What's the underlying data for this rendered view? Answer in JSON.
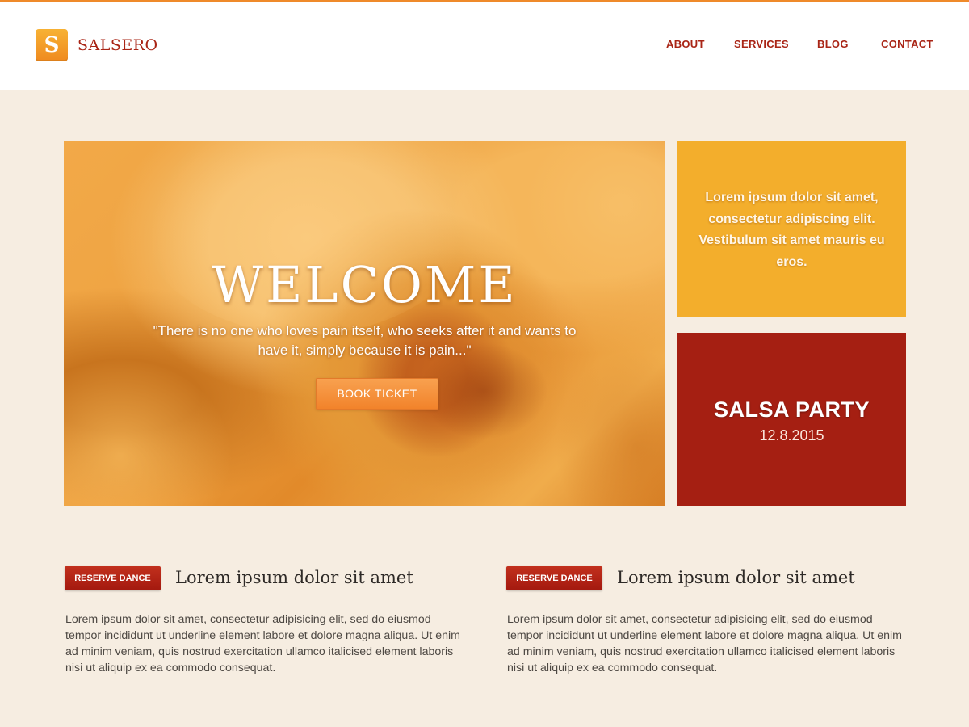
{
  "brand": {
    "logo_letter": "S",
    "name": "SALSERO",
    "accent": "#ef8a2a",
    "primary": "#a92516"
  },
  "nav": {
    "items": [
      {
        "label": "ABOUT"
      },
      {
        "label": "SERVICES"
      },
      {
        "label": "BLOG"
      },
      {
        "label": "CONTACT"
      }
    ]
  },
  "hero": {
    "title": "WELCOME",
    "quote": "\"There is no one who loves pain itself, who seeks after it and wants to have it, simply because it is pain...\"",
    "button_label": "BOOK TICKET",
    "image": "orange-rose"
  },
  "promo": {
    "text": "Lorem ipsum dolor sit amet, consectetur adipiscing elit. Vestibulum sit amet mauris eu eros.",
    "background": "#f3ae2c"
  },
  "event": {
    "title": "SALSA PARTY",
    "date": "12.8.2015",
    "background": "#a51f12"
  },
  "cards": [
    {
      "button_label": "RESERVE DANCE",
      "title": "Lorem ipsum dolor sit amet",
      "text": "Lorem ipsum dolor sit amet, consectetur adipisicing elit, sed do eiusmod tempor incididunt ut underline element labore et dolore magna aliqua. Ut enim ad minim veniam, quis nostrud exercitation ullamco italicised element laboris nisi ut aliquip ex ea commodo consequat."
    },
    {
      "button_label": "RESERVE DANCE",
      "title": "Lorem ipsum dolor sit amet",
      "text": "Lorem ipsum dolor sit amet, consectetur adipisicing elit, sed do eiusmod tempor incididunt ut underline element labore et dolore magna aliqua. Ut enim ad minim veniam, quis nostrud exercitation ullamco italicised element laboris nisi ut aliquip ex ea commodo consequat."
    }
  ]
}
